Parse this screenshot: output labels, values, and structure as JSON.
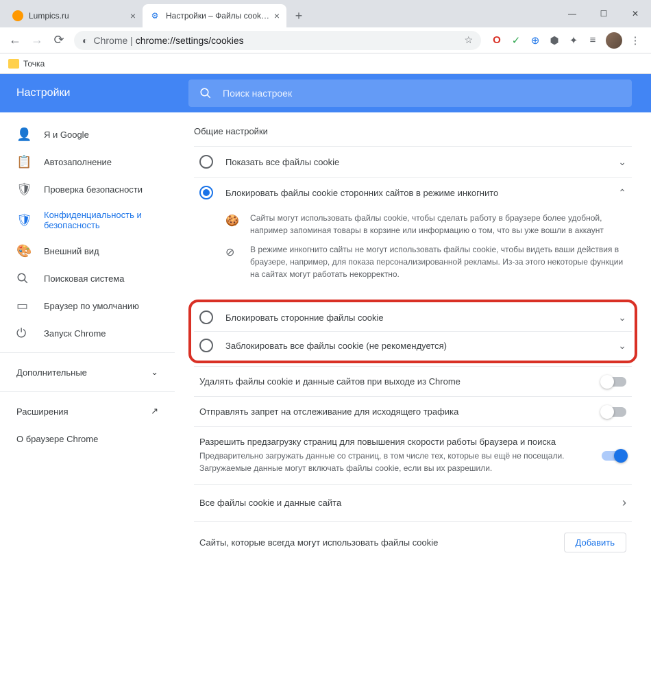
{
  "tabs": [
    {
      "title": "Lumpics.ru",
      "favicon_color": "#ff9800"
    },
    {
      "title": "Настройки – Файлы cookie и др",
      "favicon_color": "#1a73e8"
    }
  ],
  "url_prefix": "Chrome",
  "url_path": "chrome://settings/cookies",
  "bookmark": "Точка",
  "settings_title": "Настройки",
  "search_placeholder": "Поиск настроек",
  "sidebar": {
    "items": [
      "Я и Google",
      "Автозаполнение",
      "Проверка безопасности",
      "Конфиденциальность и безопасность",
      "Внешний вид",
      "Поисковая система",
      "Браузер по умолчанию",
      "Запуск Chrome"
    ],
    "advanced": "Дополнительные",
    "extensions": "Расширения",
    "about": "О браузере Chrome"
  },
  "content_title": "Общие настройки",
  "options": [
    {
      "label": "Показать все файлы cookie"
    },
    {
      "label": "Блокировать файлы cookie сторонних сайтов в режиме инкогнито"
    },
    {
      "label": "Блокировать сторонние файлы cookie"
    },
    {
      "label": "Заблокировать все файлы cookie (не рекомендуется)"
    }
  ],
  "details": [
    "Сайты могут использовать файлы cookie, чтобы сделать работу в браузере более удобной, например запоминая товары в корзине или информацию о том, что вы уже вошли в аккаунт",
    "В режиме инкогнито сайты не могут использовать файлы cookie, чтобы видеть ваши действия в браузере, например, для показа персонализированной рекламы. Из-за этого некоторые функции на сайтах могут работать некорректно."
  ],
  "settings": [
    {
      "label": "Удалять файлы cookie и данные сайтов при выходе из Chrome"
    },
    {
      "label": "Отправлять запрет на отслеживание для исходящего трафика"
    },
    {
      "label": "Разрешить предзагрузку страниц для повышения скорости работы браузера и поиска",
      "sub": "Предварительно загружать данные со страниц, в том числе тех, которые вы ещё не посещали. Загружаемые данные могут включать файлы cookie, если вы их разрешили."
    }
  ],
  "all_cookies": "Все файлы cookie и данные сайта",
  "always_allow": "Сайты, которые всегда могут использовать файлы cookie",
  "add_button": "Добавить"
}
